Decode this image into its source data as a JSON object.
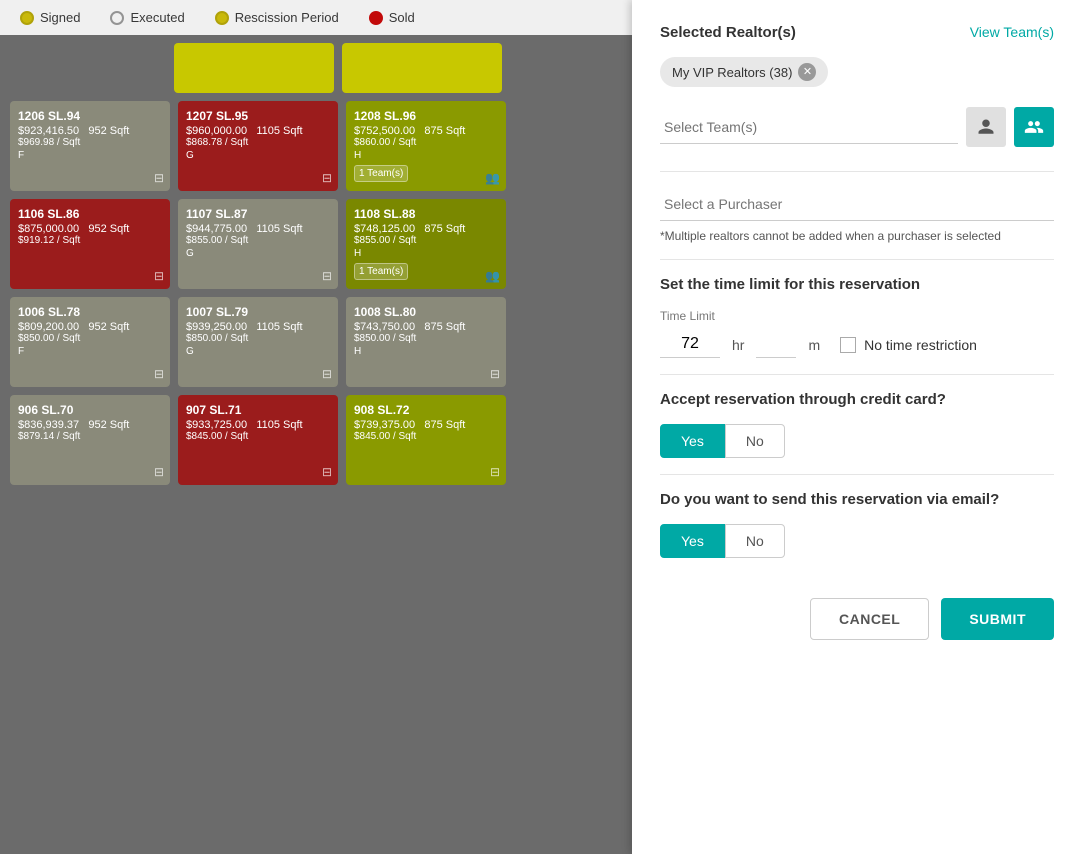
{
  "header": {
    "selected_realtors_label": "Selected Realtor(s)",
    "view_team_label": "View Team(s)",
    "chip_label": "My VIP Realtors (38)"
  },
  "team_select": {
    "placeholder": "Select Team(s)"
  },
  "purchaser": {
    "placeholder": "Select a Purchaser",
    "note": "*Multiple realtors cannot be added when a purchaser is selected"
  },
  "time_limit": {
    "section_title": "Set the time limit for this reservation",
    "label": "Time Limit",
    "hr_value": "72",
    "hr_unit": "hr",
    "m_unit": "m",
    "no_restriction_label": "No time restriction"
  },
  "credit_card": {
    "section_title": "Accept reservation through credit card?",
    "yes_label": "Yes",
    "no_label": "No"
  },
  "email": {
    "section_title": "Do you want to send this reservation via email?",
    "yes_label": "Yes",
    "no_label": "No"
  },
  "actions": {
    "cancel_label": "CANCEL",
    "submit_label": "SUBMIT"
  },
  "status_bar": {
    "signed": "Signed",
    "executed": "Executed",
    "rescission": "Rescission Period",
    "sold": "Sold"
  },
  "grid": {
    "col_headers": [
      "",
      "",
      ""
    ],
    "rows": [
      [
        {
          "id": "1206 SL.94",
          "price": "$923,416.50",
          "sqft": "952 Sqft",
          "psf": "$969.98 / Sqft",
          "floor": "F",
          "color": "gray",
          "team": null
        },
        {
          "id": "1207 SL.95",
          "price": "$960,000.00",
          "sqft": "1105 Sqft",
          "psf": "$868.78 / Sqft",
          "floor": "G",
          "color": "red",
          "team": null
        },
        {
          "id": "1208 SL.96",
          "price": "$752,500.00",
          "sqft": "875 Sqft",
          "psf": "$860.00 / Sqft",
          "floor": "H",
          "color": "olive",
          "team": "1 Team(s)"
        }
      ],
      [
        {
          "id": "1106 SL.86",
          "price": "$875,000.00",
          "sqft": "952 Sqft",
          "psf": "$919.12 / Sqft",
          "floor": "",
          "color": "red",
          "team": null
        },
        {
          "id": "1107 SL.87",
          "price": "$944,775.00",
          "sqft": "1105 Sqft",
          "psf": "$855.00 / Sqft",
          "floor": "G",
          "color": "gray",
          "team": null
        },
        {
          "id": "1108 SL.88",
          "price": "$748,125.00",
          "sqft": "875 Sqft",
          "psf": "$855.00 / Sqft",
          "floor": "H",
          "color": "dark-olive",
          "team": "1 Team(s)"
        }
      ],
      [
        {
          "id": "1006 SL.78",
          "price": "$809,200.00",
          "sqft": "952 Sqft",
          "psf": "$850.00 / Sqft",
          "floor": "F",
          "color": "gray",
          "team": null
        },
        {
          "id": "1007 SL.79",
          "price": "$939,250.00",
          "sqft": "1105 Sqft",
          "psf": "$850.00 / Sqft",
          "floor": "G",
          "color": "gray",
          "team": null
        },
        {
          "id": "1008 SL.80",
          "price": "$743,750.00",
          "sqft": "875 Sqft",
          "psf": "$850.00 / Sqft",
          "floor": "H",
          "color": "gray",
          "team": null
        }
      ],
      [
        {
          "id": "906 SL.70",
          "price": "$836,939.37",
          "sqft": "952 Sqft",
          "psf": "$879.14 / Sqft",
          "floor": "",
          "color": "gray",
          "team": null
        },
        {
          "id": "907 SL.71",
          "price": "$933,725.00",
          "sqft": "1105 Sqft",
          "psf": "$845.00 / Sqft",
          "floor": "",
          "color": "red",
          "team": null
        },
        {
          "id": "908 SL.72",
          "price": "$739,375.00",
          "sqft": "875 Sqft",
          "psf": "$845.00 / Sqft",
          "floor": "",
          "color": "olive",
          "team": null
        }
      ]
    ]
  }
}
